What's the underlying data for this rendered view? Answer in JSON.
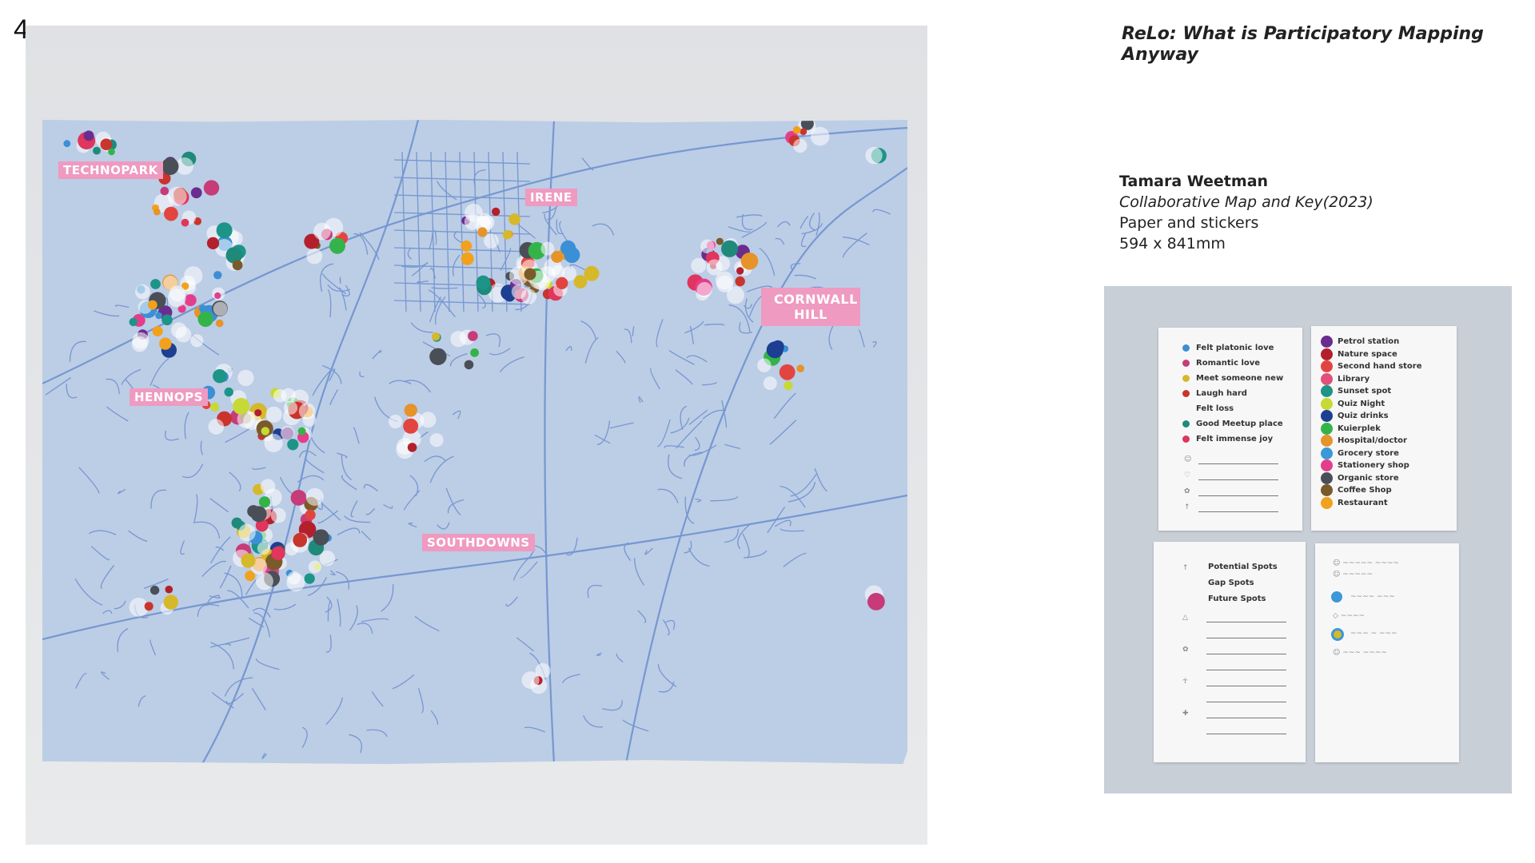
{
  "page": {
    "number": "4"
  },
  "document": {
    "title": "ReLo: What is Participatory Mapping Anyway"
  },
  "caption": {
    "artist": "Tamara Weetman",
    "work": "Collaborative Map and Key(2023)",
    "medium": "Paper and stickers",
    "dimensions": "594 x 841mm"
  },
  "map": {
    "labels": {
      "technopark": "TECHNOPARK",
      "irene": "IRENE",
      "hennops": "HENNOPS",
      "southdowns": "SOUTHDOWNS",
      "cornwall_hill": "CORNWALL HILL"
    }
  },
  "key": {
    "emotions": [
      {
        "label": "Felt platonic love",
        "color": "#3b8fd6"
      },
      {
        "label": "Romantic love",
        "color": "#c63b78"
      },
      {
        "label": "Meet someone new",
        "color": "#d6b82b"
      },
      {
        "label": "Laugh hard",
        "color": "#c9342c"
      },
      {
        "label": "Felt loss",
        "color": ""
      },
      {
        "label": "Good Meetup place",
        "color": "#1f8a7a"
      },
      {
        "label": "Felt immense joy",
        "color": "#e0355c"
      }
    ],
    "places": [
      {
        "label": "Petrol station",
        "color": "#6a2d8f"
      },
      {
        "label": "Nature space",
        "color": "#b3202c"
      },
      {
        "label": "Second hand store",
        "color": "#e2453f"
      },
      {
        "label": "Library",
        "color": "#e0507a"
      },
      {
        "label": "Sunset spot",
        "color": "#1d9488"
      },
      {
        "label": "Quiz Night",
        "color": "#c7d934"
      },
      {
        "label": "Quiz drinks",
        "color": "#1c3f91"
      },
      {
        "label": "Kuierplek",
        "color": "#34b34a"
      },
      {
        "label": "Hospital/doctor",
        "color": "#e6932a"
      },
      {
        "label": "Grocery store",
        "color": "#3a98d8"
      },
      {
        "label": "Stationery shop",
        "color": "#e43d8c"
      },
      {
        "label": "Organic store",
        "color": "#4a4f57"
      },
      {
        "label": "Coffee Shop",
        "color": "#7b5a2a"
      },
      {
        "label": "Restaurant",
        "color": "#f2a11c"
      }
    ],
    "spots": [
      {
        "label": "Potential Spots"
      },
      {
        "label": "Gap Spots"
      },
      {
        "label": "Future Spots"
      }
    ]
  }
}
